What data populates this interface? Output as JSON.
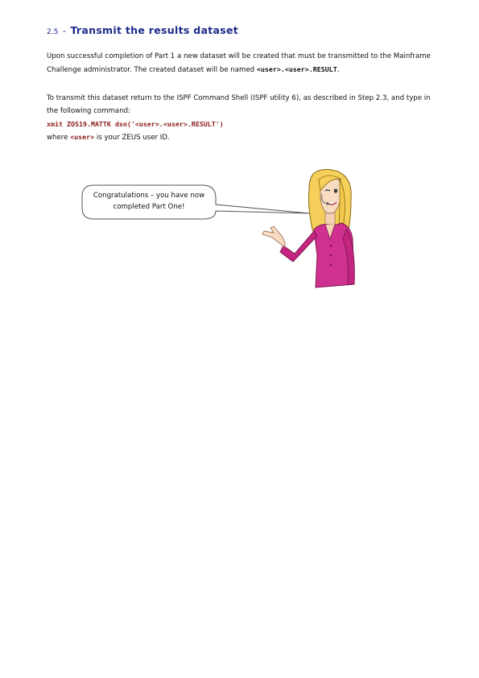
{
  "section": {
    "number": "2.5",
    "dash": "-",
    "title": "Transmit the results dataset"
  },
  "paragraph1": {
    "text": "Upon successful completion of Part 1 a new dataset will be created that must be transmitted to the Mainframe Challenge administrator. The created dataset will be named ",
    "dataset_name": "<user>.<user>.RESULT",
    "end": "."
  },
  "paragraph2": {
    "line": "To transmit this dataset return to the ISPF Command Shell (ISPF utility 6), as described in Step 2.3, and type in the following command:",
    "command": "xmit ZOS19.MATTK dsn('<user>.<user>.RESULT')",
    "where_prefix": "where ",
    "where_user": "<user>",
    "where_suffix": " is your ZEUS user ID."
  },
  "speech_bubble": {
    "text": "Congratulations – you have now completed Part One!"
  },
  "colors": {
    "heading": "#1c2a8a",
    "code": "#8b1a1a",
    "top_magenta": "#d0308f"
  }
}
